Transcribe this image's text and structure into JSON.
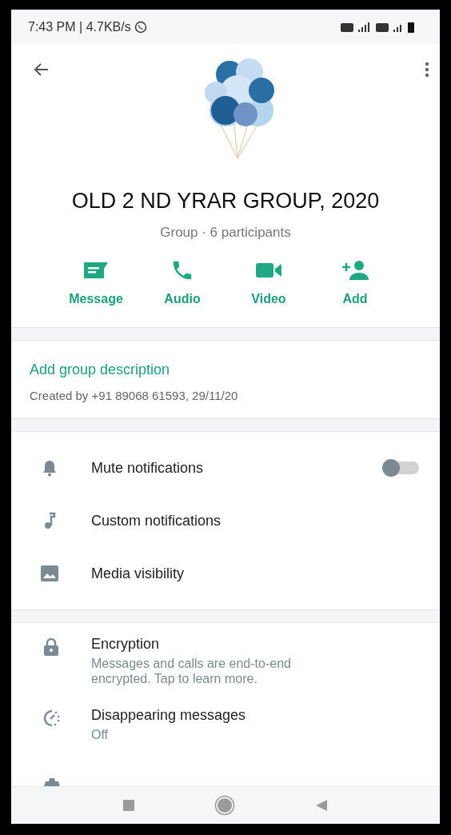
{
  "status_bar": {
    "time": "7:43 PM | 4.7KB/s"
  },
  "group": {
    "name": "OLD 2 ND YRAR GROUP, 2020",
    "subtitle": "Group · 6 participants"
  },
  "actions": [
    {
      "kind": "message",
      "label": "Message"
    },
    {
      "kind": "audio",
      "label": "Audio"
    },
    {
      "kind": "video",
      "label": "Video"
    },
    {
      "kind": "add",
      "label": "Add"
    }
  ],
  "description": {
    "link": "Add group description",
    "created": "Created by +91 89068 61593, 29/11/20"
  },
  "settings": [
    {
      "kind": "bell",
      "label": "Mute notifications",
      "on": false
    },
    {
      "kind": "note",
      "label": "Custom notifications"
    },
    {
      "kind": "image",
      "label": "Media visibility"
    }
  ],
  "privacy": [
    {
      "kind": "lock",
      "label": "Encryption",
      "detail": "Messages and calls are end-to-end encrypted. Tap to learn more."
    },
    {
      "kind": "timer",
      "label": "Disappearing messages",
      "detail": "Off"
    }
  ]
}
